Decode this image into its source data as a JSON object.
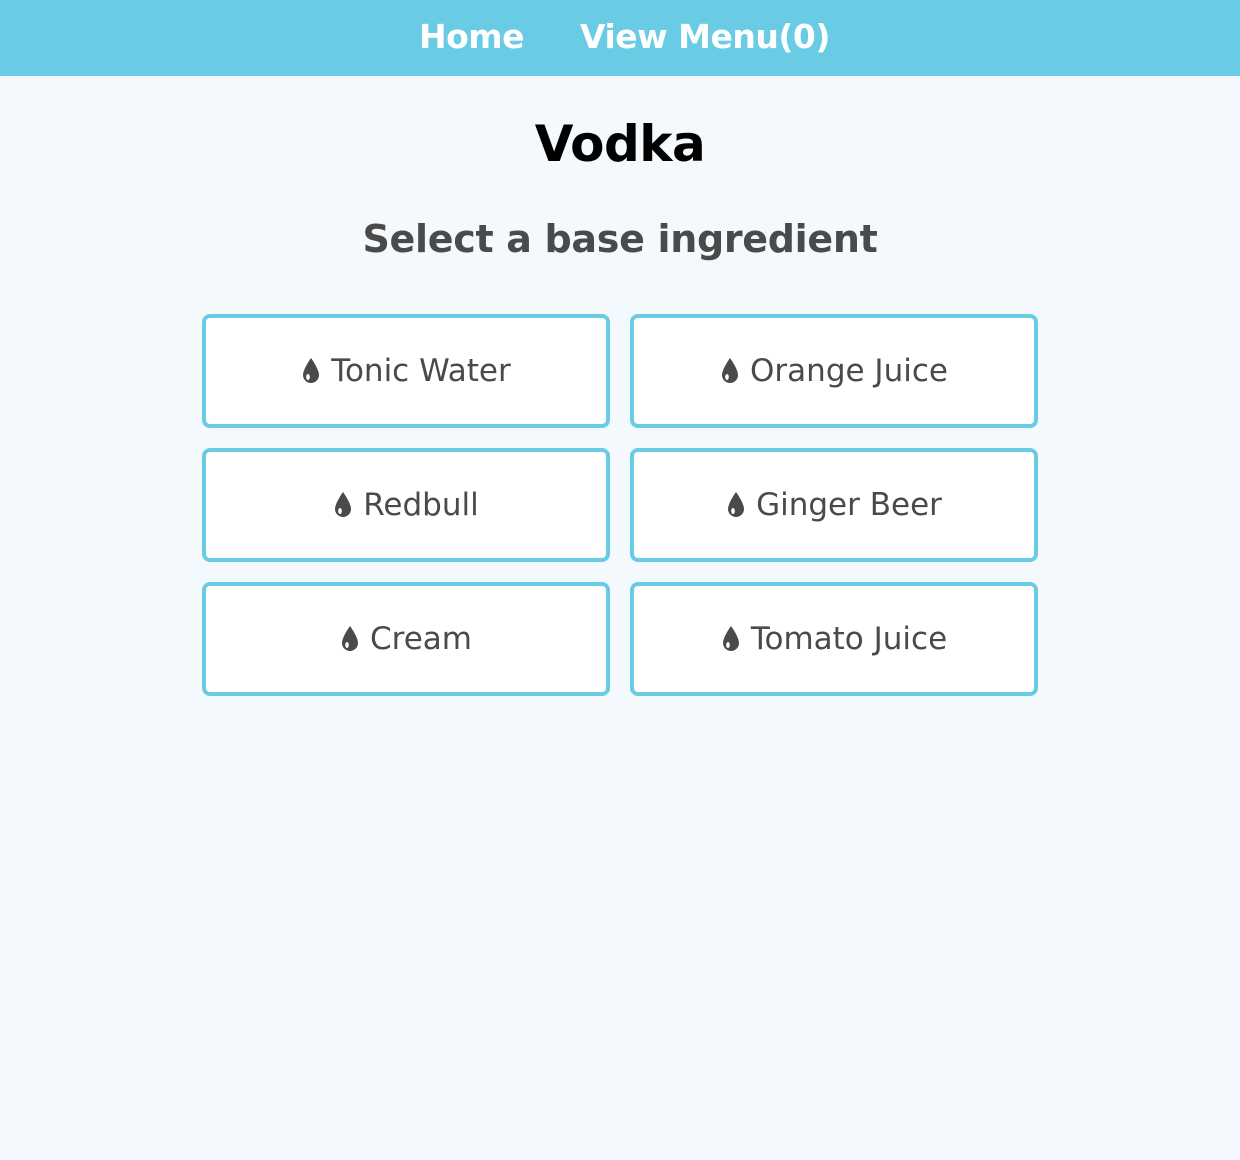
{
  "nav": {
    "home_label": "Home",
    "menu_label": "View Menu(0)"
  },
  "page": {
    "title": "Vodka",
    "subtitle": "Select a base ingredient"
  },
  "ingredients": [
    {
      "label": "Tonic Water",
      "icon": "drop-icon"
    },
    {
      "label": "Orange Juice",
      "icon": "drop-icon"
    },
    {
      "label": "Redbull",
      "icon": "drop-icon"
    },
    {
      "label": "Ginger Beer",
      "icon": "drop-icon"
    },
    {
      "label": "Cream",
      "icon": "drop-icon"
    },
    {
      "label": "Tomato Juice",
      "icon": "drop-icon"
    }
  ],
  "colors": {
    "accent": "#69cbe4",
    "background": "#f3f9fc",
    "text": "#4a4a4a"
  }
}
